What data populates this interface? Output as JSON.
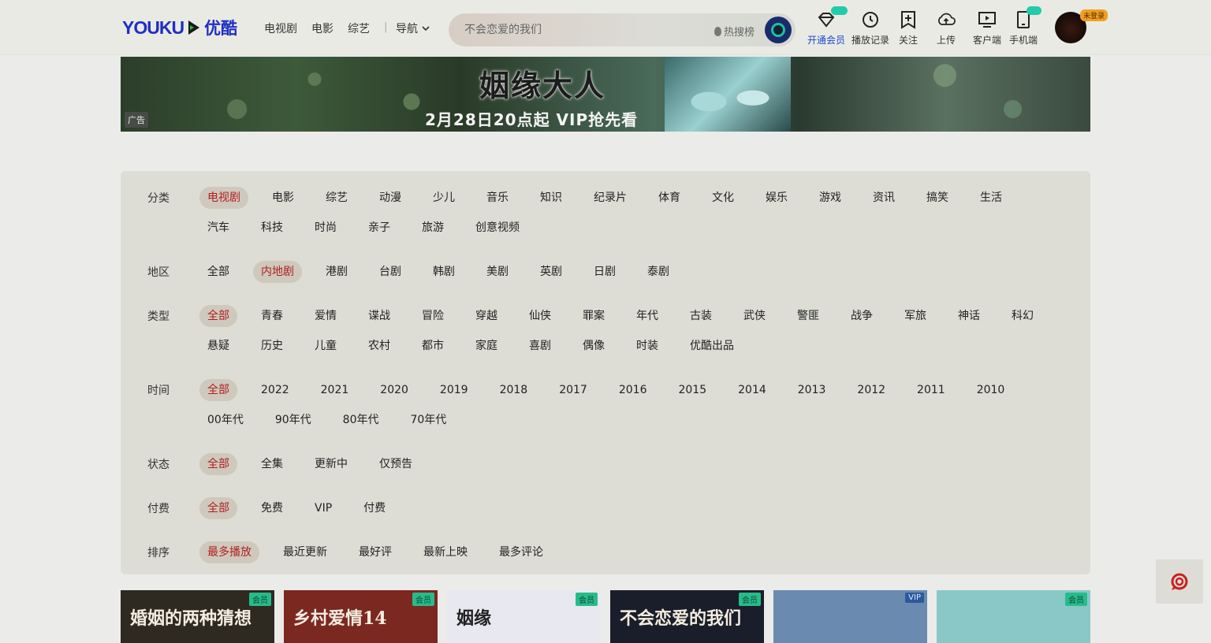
{
  "header": {
    "logo_en": "YOUKU",
    "logo_cn": "优酷",
    "nav": [
      "电视剧",
      "电影",
      "综艺"
    ],
    "nav_menu": "导航",
    "search_placeholder": "不会恋爱的我们",
    "hot_search": "热搜榜",
    "tools": [
      {
        "label": "开通会员",
        "icon": "diamond-icon"
      },
      {
        "label": "播放记录",
        "icon": "clock-icon"
      },
      {
        "label": "关注",
        "icon": "bookmark-plus-icon"
      },
      {
        "label": "上传",
        "icon": "cloud-upload-icon"
      },
      {
        "label": "客户端",
        "icon": "monitor-play-icon"
      },
      {
        "label": "手机端",
        "icon": "phone-icon"
      }
    ],
    "login_tag": "未登录"
  },
  "banner": {
    "title": "姻缘大人",
    "subtitle": "2月28日20点起 VIP抢先看",
    "ad_label": "广告"
  },
  "filters": [
    {
      "label": "分类",
      "options": [
        "电视剧",
        "电影",
        "综艺",
        "动漫",
        "少儿",
        "音乐",
        "知识",
        "纪录片",
        "体育",
        "文化",
        "娱乐",
        "游戏",
        "资讯",
        "搞笑",
        "生活",
        "汽车",
        "科技",
        "时尚",
        "亲子",
        "旅游",
        "创意视频"
      ],
      "active": 0
    },
    {
      "label": "地区",
      "options": [
        "全部",
        "内地剧",
        "港剧",
        "台剧",
        "韩剧",
        "美剧",
        "英剧",
        "日剧",
        "泰剧"
      ],
      "active": 1
    },
    {
      "label": "类型",
      "options": [
        "全部",
        "青春",
        "爱情",
        "谍战",
        "冒险",
        "穿越",
        "仙侠",
        "罪案",
        "年代",
        "古装",
        "武侠",
        "警匪",
        "战争",
        "军旅",
        "神话",
        "科幻",
        "悬疑",
        "历史",
        "儿童",
        "农村",
        "都市",
        "家庭",
        "喜剧",
        "偶像",
        "时装",
        "优酷出品"
      ],
      "active": 0
    },
    {
      "label": "时间",
      "options": [
        "全部",
        "2022",
        "2021",
        "2020",
        "2019",
        "2018",
        "2017",
        "2016",
        "2015",
        "2014",
        "2013",
        "2012",
        "2011",
        "2010",
        "00年代",
        "90年代",
        "80年代",
        "70年代"
      ],
      "active": 0
    },
    {
      "label": "状态",
      "options": [
        "全部",
        "全集",
        "更新中",
        "仅预告"
      ],
      "active": 0
    },
    {
      "label": "付费",
      "options": [
        "全部",
        "免费",
        "VIP",
        "付费"
      ],
      "active": 0
    },
    {
      "label": "排序",
      "options": [
        "最多播放",
        "最近更新",
        "最好评",
        "最新上映",
        "最多评论"
      ],
      "active": 0
    }
  ],
  "cards": [
    {
      "title": "婚姻的两种猜想",
      "tag": "会员",
      "bg": "#2e2a22"
    },
    {
      "title": "乡村爱情14",
      "tag": "会员",
      "bg": "#7a2820"
    },
    {
      "title": "姻缘",
      "tag": "会员",
      "bg": "#e8e8f0"
    },
    {
      "title": "不会恋爱的我们",
      "tag": "会员",
      "bg": "#1a1e2a"
    },
    {
      "title": "",
      "tag": "VIP",
      "bg": "#6a8ab0"
    },
    {
      "title": "",
      "tag": "会员",
      "bg": "#8ac8c8"
    }
  ]
}
